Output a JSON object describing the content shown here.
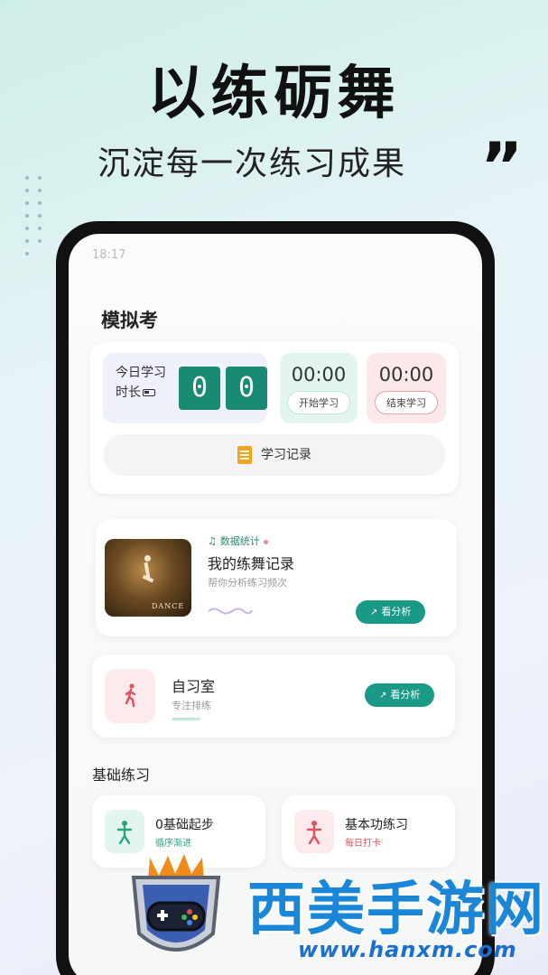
{
  "header": {
    "headline": "以练砺舞",
    "subline": "沉淀每一次练习成果",
    "quote_mark": "”"
  },
  "status_bar": {
    "time": "18:17",
    "indicators": ""
  },
  "page": {
    "title": "模拟考"
  },
  "timer": {
    "today_label": "今日学习时长",
    "digits": [
      "0",
      "0"
    ],
    "start_time": "00:00",
    "start_button": "开始学习",
    "end_time": "00:00",
    "end_button": "结束学习",
    "record_button": "学习记录"
  },
  "dance_record": {
    "tag": "数据统计",
    "title": "我的练舞记录",
    "subtitle": "帮你分析练习频次",
    "thumb_text": "DANCE",
    "button": "看分析"
  },
  "study_room": {
    "title": "自习室",
    "subtitle": "专注排练",
    "button": "看分析"
  },
  "basic": {
    "section_title": "基础练习",
    "items": [
      {
        "title": "0基础起步",
        "subtitle": "循序渐进",
        "color": "#2aa47e",
        "bg": "#e2f6ef"
      },
      {
        "title": "基本功练习",
        "subtitle": "每日打卡",
        "color": "#e0505e",
        "bg": "#fdeaec"
      }
    ]
  },
  "watermark": {
    "brand": "西美手游网",
    "url": "www.hanxm.com"
  },
  "colors": {
    "accent": "#1a9a86",
    "digit_bg": "#1a8a74"
  }
}
